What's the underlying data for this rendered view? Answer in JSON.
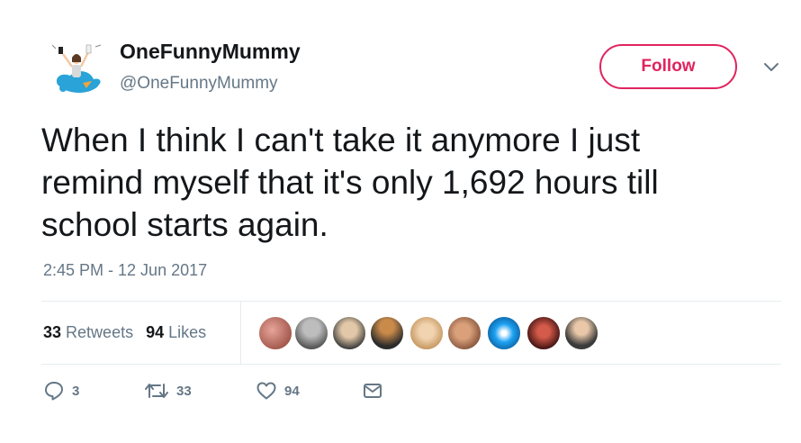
{
  "user": {
    "display_name": "OneFunnyMummy",
    "handle": "@OneFunnyMummy"
  },
  "follow_label": "Follow",
  "tweet": {
    "text": "When I think I can't take it anymore I just\nremind myself that it's only 1,692 hours till\nschool starts again.",
    "timestamp": "2:45 PM - 12 Jun 2017"
  },
  "stats": {
    "retweets": {
      "count": "33",
      "label": "Retweets"
    },
    "likes": {
      "count": "94",
      "label": "Likes"
    }
  },
  "actions": {
    "reply": {
      "icon": "reply-icon",
      "count": "3"
    },
    "retweet": {
      "icon": "retweet-icon",
      "count": "33"
    },
    "like": {
      "icon": "heart-icon",
      "count": "94"
    },
    "dm": {
      "icon": "mail-icon"
    }
  },
  "colors": {
    "accent": "#e0245e",
    "text": "#14171a",
    "secondary": "#657786",
    "divider": "#e6ecf0",
    "twitter_blue": "#1da1f2"
  }
}
